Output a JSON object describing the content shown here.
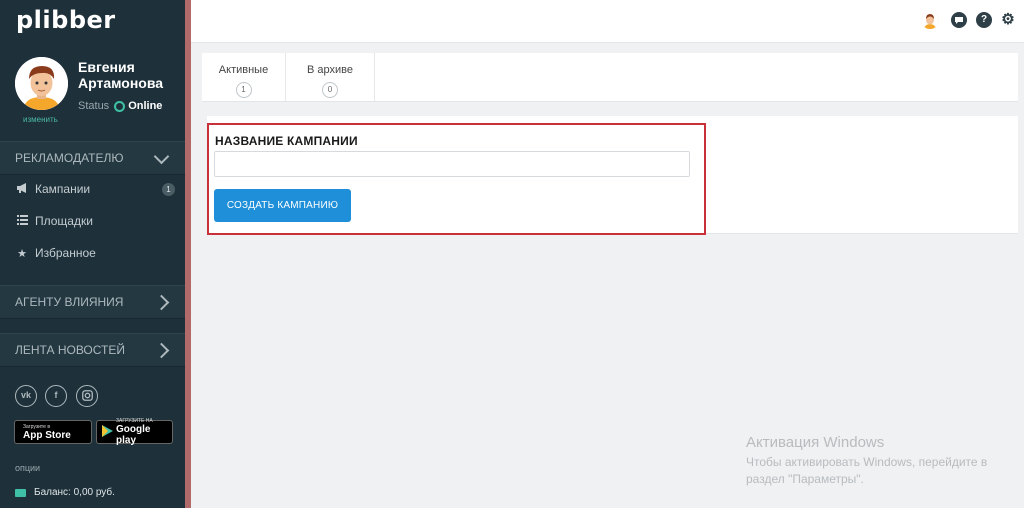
{
  "brand": {
    "logo_text": "plibber"
  },
  "user": {
    "name": "Евгения Артамонова",
    "change_link": "изменить",
    "status_label": "Status",
    "status_value": "Online"
  },
  "sidebar": {
    "section_advertiser": "РЕКЛАМОДАТЕЛЮ",
    "items": [
      {
        "label": "Кампании",
        "icon": "megaphone-icon",
        "badge": "1"
      },
      {
        "label": "Площадки",
        "icon": "list-icon"
      },
      {
        "label": "Избранное",
        "icon": "star-icon"
      }
    ],
    "section_agent": "АГЕНТУ ВЛИЯНИЯ",
    "section_news": "ЛЕНТА НОВОСТЕЙ",
    "social_icons": [
      "vk-icon",
      "facebook-icon",
      "instagram-icon"
    ],
    "app_store": {
      "small": "Загрузите в",
      "big": "App Store"
    },
    "google_play": {
      "small": "ЗАГРУЗИТЕ НА",
      "big": "Google play"
    },
    "options_label": "опции",
    "balance": "Баланс: 0,00 руб."
  },
  "topbar": {
    "icons": [
      "user-avatar-icon",
      "chat-icon",
      "help-icon",
      "settings-icon"
    ]
  },
  "tabs": [
    {
      "label": "Активные",
      "count": "1"
    },
    {
      "label": "В архиве",
      "count": "0"
    }
  ],
  "form": {
    "label": "НАЗВАНИЕ КАМПАНИИ",
    "input_value": "",
    "button": "СОЗДАТЬ КАМПАНИЮ"
  },
  "watermark": {
    "title": "Активация Windows",
    "text": "Чтобы активировать Windows, перейдите в раздел \"Параметры\"."
  },
  "colors": {
    "sidebar_bg": "#1e313a",
    "accent": "#1e8fd8",
    "online": "#3fc1a8",
    "highlight_border": "#c8303a"
  }
}
